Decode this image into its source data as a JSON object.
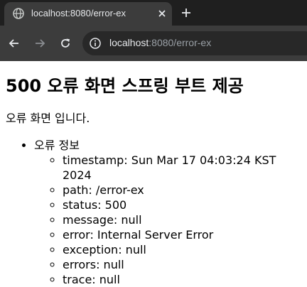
{
  "browser": {
    "tab_title": "localhost:8080/error-ex",
    "url_host": "localhost",
    "url_rest": ":8080/error-ex"
  },
  "page": {
    "heading": "500 오류 화면 스프링 부트 제공",
    "message": "오류 화면 입니다.",
    "section_label": "오류 정보",
    "details": [
      "timestamp: Sun Mar 17 04:03:24 KST 2024",
      "path: /error-ex",
      "status: 500",
      "message: null",
      "error: Internal Server Error",
      "exception: null",
      "errors: null",
      "trace: null"
    ]
  },
  "colors": {
    "tabbar_bg": "#1f1f1f",
    "toolbar_bg": "#3c3c3c",
    "omnibox_bg": "#282828",
    "chrome_text": "#e8eaed",
    "chrome_muted": "#9aa0a6"
  }
}
